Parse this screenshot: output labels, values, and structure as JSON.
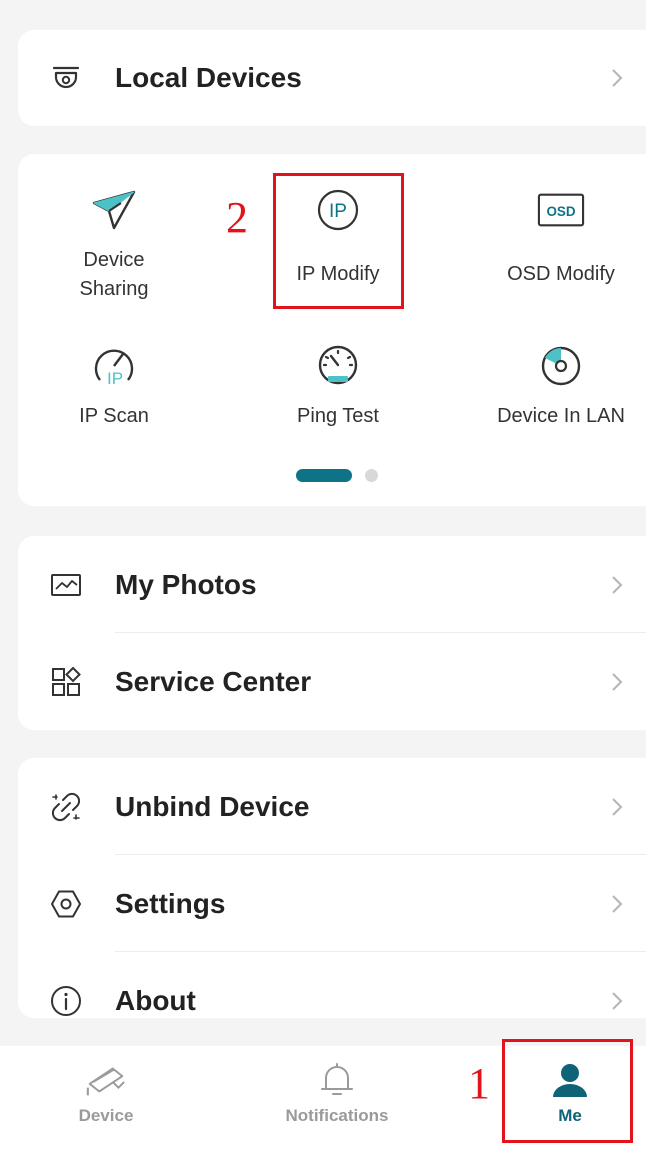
{
  "local_devices": {
    "label": "Local Devices"
  },
  "tools": [
    {
      "name": "device-sharing",
      "label": "Device Sharing",
      "line1": "Device",
      "line2": "Sharing",
      "icon": "paper-plane-icon"
    },
    {
      "name": "ip-modify",
      "label": "IP Modify",
      "icon": "ip-circle-icon"
    },
    {
      "name": "osd-modify",
      "label": "OSD Modify",
      "icon": "osd-icon"
    },
    {
      "name": "ip-scan",
      "label": "IP Scan",
      "icon": "ip-scan-icon"
    },
    {
      "name": "ping-test",
      "label": "Ping Test",
      "icon": "speedometer-icon"
    },
    {
      "name": "device-in-lan",
      "label": "Device In LAN",
      "icon": "radar-icon"
    }
  ],
  "pager": {
    "page_count": 2,
    "active_page": 1
  },
  "media": {
    "my_photos": "My Photos",
    "service_center": "Service Center"
  },
  "manage": {
    "unbind_device": "Unbind Device",
    "settings": "Settings",
    "about": "About"
  },
  "tabbar": {
    "items": [
      {
        "label": "Device",
        "icon": "camera-icon",
        "active": false
      },
      {
        "label": "Notifications",
        "icon": "bell-icon",
        "active": false
      },
      {
        "label": "Me",
        "icon": "person-icon",
        "active": true
      }
    ]
  },
  "annotations": {
    "step1": "1",
    "step2": "2"
  },
  "colors": {
    "accent": "#0f7387",
    "teal_light": "#4cc2c6",
    "annotation_red": "#e0141a"
  }
}
